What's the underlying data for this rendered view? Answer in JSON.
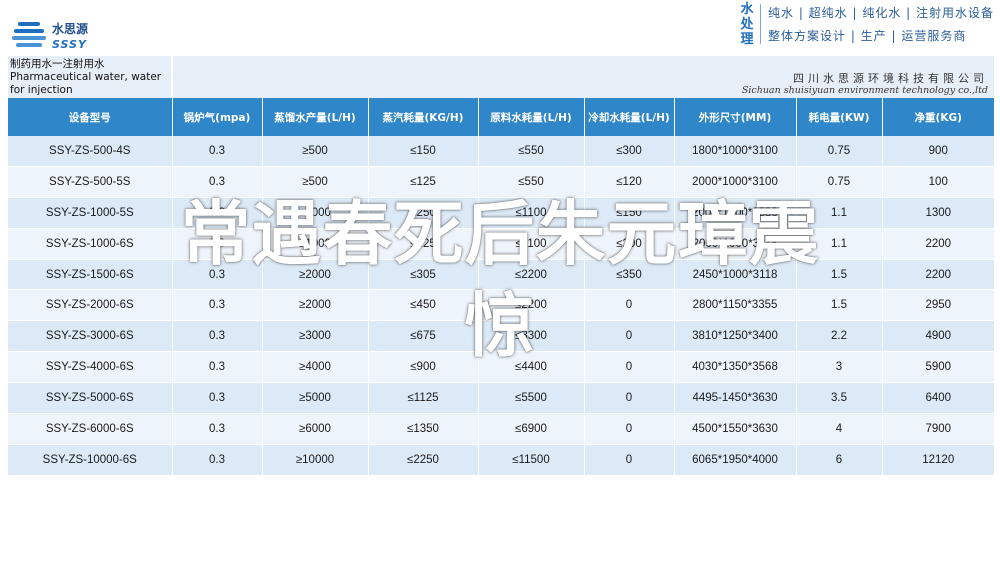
{
  "logo": {
    "name": "水思源",
    "sub": "SSSY"
  },
  "slogan": {
    "brand": "水处理",
    "line1": "纯水 | 超纯水 | 纯化水 | 注射用水设备",
    "line2": "整体方案设计 | 生产 | 运营服务商"
  },
  "title": {
    "cn": "制药用水一注射用水",
    "en": "Pharmaceutical water, water for injection"
  },
  "company": {
    "cn": "四川水思源环境科技有限公司",
    "en": "Sichuan shuisiyuan environment technology co.,ltd"
  },
  "table": {
    "headers": [
      "设备型号",
      "锅炉气(mpa)",
      "蒸馏水产量(L/H)",
      "蒸汽耗量(KG/H)",
      "原料水耗量(L/H)",
      "冷却水耗量(L/H)",
      "外形尺寸(MM)",
      "耗电量(KW)",
      "净重(KG)"
    ],
    "rows": [
      [
        "SSY-ZS-500-4S",
        "0.3",
        "≥500",
        "≤150",
        "≤550",
        "≤300",
        "1800*1000*3100",
        "0.75",
        "900"
      ],
      [
        "SSY-ZS-500-5S",
        "0.3",
        "≥500",
        "≤125",
        "≤550",
        "≤120",
        "2000*1000*3100",
        "0.75",
        "100"
      ],
      [
        "SSY-ZS-1000-5S",
        "0.3",
        "≥1000",
        "≤250",
        "≤1100",
        "≤150",
        "2000*1000*3380",
        "1.1",
        "1300"
      ],
      [
        "SSY-ZS-1000-6S",
        "0.3",
        "≥1000",
        "≤225",
        "≤1100",
        "≤200",
        "2000*1000*3118",
        "1.1",
        "2200"
      ],
      [
        "SSY-ZS-1500-6S",
        "0.3",
        "≥2000",
        "≤305",
        "≤2200",
        "≤350",
        "2450*1000*3118",
        "1.5",
        "2200"
      ],
      [
        "SSY-ZS-2000-6S",
        "0.3",
        "≥2000",
        "≤450",
        "≤2200",
        "0",
        "2800*1150*3355",
        "1.5",
        "2950"
      ],
      [
        "SSY-ZS-3000-6S",
        "0.3",
        "≥3000",
        "≤675",
        "≤3300",
        "0",
        "3810*1250*3400",
        "2.2",
        "4900"
      ],
      [
        "SSY-ZS-4000-6S",
        "0.3",
        "≥4000",
        "≤900",
        "≤4400",
        "0",
        "4030*1350*3568",
        "3",
        "5900"
      ],
      [
        "SSY-ZS-5000-6S",
        "0.3",
        "≥5000",
        "≤1125",
        "≤5500",
        "0",
        "4495-1450*3630",
        "3.5",
        "6400"
      ],
      [
        "SSY-ZS-6000-6S",
        "0.3",
        "≥6000",
        "≤1350",
        "≤6900",
        "0",
        "4500*1550*3630",
        "4",
        "7900"
      ],
      [
        "SSY-ZS-10000-6S",
        "0.3",
        "≥10000",
        "≤2250",
        "≤11500",
        "0",
        "6065*1950*4000",
        "6",
        "12120"
      ]
    ]
  },
  "overlay": {
    "line1": "常遇春死后朱元璋震",
    "line2": "惊"
  }
}
